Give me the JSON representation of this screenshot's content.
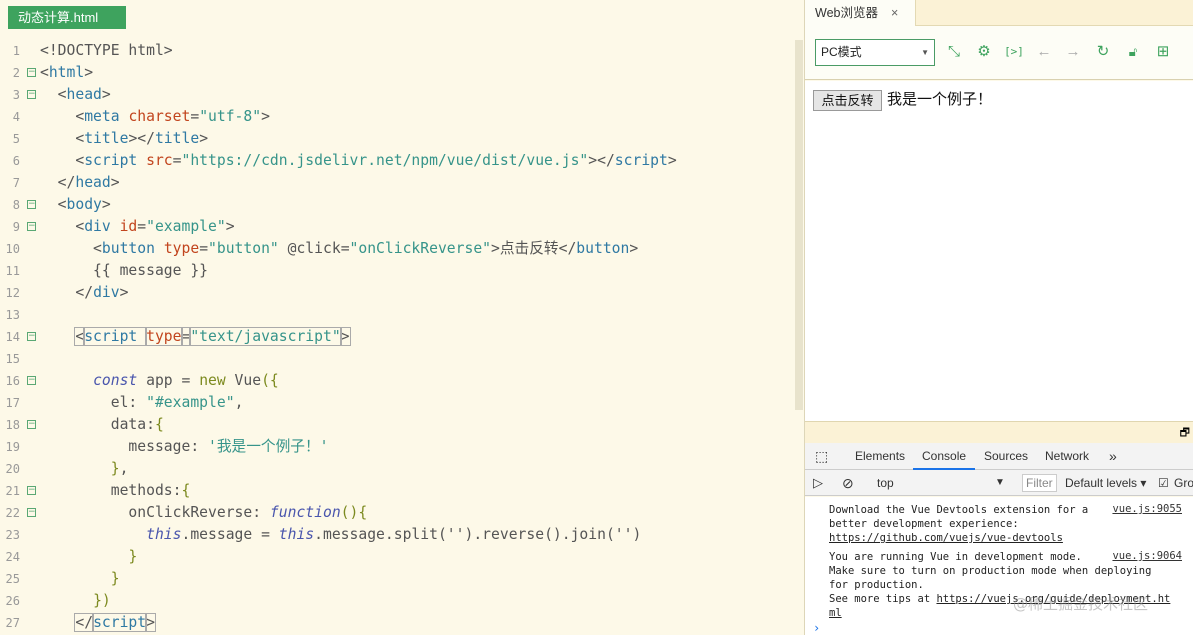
{
  "editor": {
    "file_tab": "动态计算.html",
    "lines": [
      [
        [
          "<!DOCTYPE html>",
          "p"
        ]
      ],
      [
        [
          "<",
          "p"
        ],
        [
          "html",
          "n"
        ],
        [
          ">",
          "p"
        ]
      ],
      [
        [
          "  <",
          "p"
        ],
        [
          "head",
          "n"
        ],
        [
          ">",
          "p"
        ]
      ],
      [
        [
          "    <",
          "p"
        ],
        [
          "meta ",
          "n"
        ],
        [
          "charset",
          "a"
        ],
        [
          "=",
          "p"
        ],
        [
          "\"utf-8\"",
          "s"
        ],
        [
          ">",
          "p"
        ]
      ],
      [
        [
          "    <",
          "p"
        ],
        [
          "title",
          "n"
        ],
        [
          "></",
          "p"
        ],
        [
          "title",
          "n"
        ],
        [
          ">",
          "p"
        ]
      ],
      [
        [
          "    <",
          "p"
        ],
        [
          "script ",
          "n"
        ],
        [
          "src",
          "a"
        ],
        [
          "=",
          "p"
        ],
        [
          "\"https://cdn.jsdelivr.net/npm/vue/dist/vue.js\"",
          "s"
        ],
        [
          "></",
          "p"
        ],
        [
          "script",
          "n"
        ],
        [
          ">",
          "p"
        ]
      ],
      [
        [
          "  </",
          "p"
        ],
        [
          "head",
          "n"
        ],
        [
          ">",
          "p"
        ]
      ],
      [
        [
          "  <",
          "p"
        ],
        [
          "body",
          "n"
        ],
        [
          ">",
          "p"
        ]
      ],
      [
        [
          "    <",
          "p"
        ],
        [
          "div ",
          "n"
        ],
        [
          "id",
          "a"
        ],
        [
          "=",
          "p"
        ],
        [
          "\"example\"",
          "s"
        ],
        [
          ">",
          "p"
        ]
      ],
      [
        [
          "      <",
          "p"
        ],
        [
          "button ",
          "n"
        ],
        [
          "type",
          "a"
        ],
        [
          "=",
          "p"
        ],
        [
          "\"button\"",
          "s"
        ],
        [
          " @click",
          "p"
        ],
        [
          "=",
          "p"
        ],
        [
          "\"onClickReverse\"",
          "s"
        ],
        [
          ">点击反转</",
          "p"
        ],
        [
          "button",
          "n"
        ],
        [
          ">",
          "p"
        ]
      ],
      [
        [
          "      {{ message }}",
          "p"
        ]
      ],
      [
        [
          "    </",
          "p"
        ],
        [
          "div",
          "n"
        ],
        [
          ">",
          "p"
        ]
      ],
      [],
      [
        [
          "    ",
          "p"
        ],
        [
          "<",
          "p box"
        ],
        [
          "script ",
          "n box"
        ],
        [
          "type",
          "a box"
        ],
        [
          "=",
          "p box"
        ],
        [
          "\"text/javascript\"",
          "s box"
        ],
        [
          ">",
          "p box"
        ]
      ],
      [],
      [
        [
          "      ",
          "p"
        ],
        [
          "const",
          "k"
        ],
        [
          " app = ",
          "p"
        ],
        [
          "new",
          "b"
        ],
        [
          " Vue",
          "p"
        ],
        [
          "({",
          "b"
        ]
      ],
      [
        [
          "        el: ",
          "p"
        ],
        [
          "\"#example\"",
          "s"
        ],
        [
          ",",
          "p"
        ]
      ],
      [
        [
          "        data:",
          "p"
        ],
        [
          "{",
          "b"
        ]
      ],
      [
        [
          "          message: ",
          "p"
        ],
        [
          "'我是一个例子！'",
          "s"
        ]
      ],
      [
        [
          "        ",
          "p"
        ],
        [
          "}",
          "b"
        ],
        [
          ",",
          "p"
        ]
      ],
      [
        [
          "        methods:",
          "p"
        ],
        [
          "{",
          "b"
        ]
      ],
      [
        [
          "          onClickReverse: ",
          "p"
        ],
        [
          "function",
          "k"
        ],
        [
          "(){",
          "b"
        ]
      ],
      [
        [
          "            ",
          "p"
        ],
        [
          "this",
          "k"
        ],
        [
          ".message = ",
          "p"
        ],
        [
          "this",
          "k"
        ],
        [
          ".message.split('').reverse().join('')",
          "p"
        ]
      ],
      [
        [
          "          ",
          "p"
        ],
        [
          "}",
          "b"
        ]
      ],
      [
        [
          "        ",
          "p"
        ],
        [
          "}",
          "b"
        ]
      ],
      [
        [
          "      ",
          "p"
        ],
        [
          "})",
          "b"
        ]
      ],
      [
        [
          "    ",
          "p"
        ],
        [
          "</",
          "p box"
        ],
        [
          "script",
          "n box"
        ],
        [
          ">",
          "p box"
        ]
      ]
    ],
    "fold_lines": [
      2,
      3,
      8,
      9,
      14,
      16,
      18,
      21,
      22
    ]
  },
  "browser": {
    "tab_label": "Web浏览器",
    "tab_close": "×",
    "mode_select": "PC模式",
    "page": {
      "button_label": "点击反转",
      "message": "我是一个例子！"
    }
  },
  "devtools": {
    "tabs": [
      "Elements",
      "Console",
      "Sources",
      "Network",
      "»"
    ],
    "active_tab": "Console",
    "context": "top",
    "filter_placeholder": "Filter",
    "levels": "Default levels ▾",
    "group_label": "Gro",
    "messages": [
      {
        "text": "Download the Vue Devtools extension for a\nbetter development experience:",
        "link": "https://github.com/vuejs/vue-devtools",
        "source": "vue.js:9055"
      },
      {
        "text": "You are running Vue in development mode.\nMake sure to turn on production mode when deploying\nfor production.\nSee more tips at ",
        "link": "https://vuejs.org/guide/deployment.ht\nml",
        "source": "vue.js:9064"
      }
    ],
    "prompt": "›"
  },
  "watermark": "@稀土掘金技术社区"
}
